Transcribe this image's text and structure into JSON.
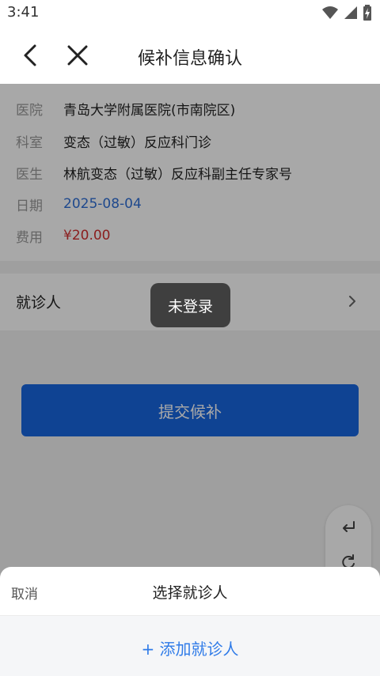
{
  "status_bar": {
    "time": "3:41",
    "icons": [
      "wifi-icon",
      "signal-icon",
      "battery-icon"
    ]
  },
  "nav": {
    "title": "候补信息确认",
    "back_icon": "chevron-left-icon",
    "close_icon": "close-icon"
  },
  "info": {
    "hospital_label": "医院",
    "hospital_value": "青岛大学附属医院(市南院区)",
    "department_label": "科室",
    "department_value": "变态（过敏）反应科门诊",
    "doctor_label": "医生",
    "doctor_value": "林航变态（过敏）反应科副主任专家号",
    "date_label": "日期",
    "date_value": "2025-08-04",
    "fee_label": "费用",
    "fee_value": "¥20.00"
  },
  "patient": {
    "label": "就诊人",
    "chevron_icon": "chevron-right-icon"
  },
  "submit": {
    "label": "提交候补"
  },
  "float_tools": {
    "icons": [
      "return-icon",
      "refresh-icon"
    ]
  },
  "toast": {
    "text": "未登录"
  },
  "sheet": {
    "cancel_label": "取消",
    "title": "选择就诊人",
    "add_label": "+ 添加就诊人"
  },
  "colors": {
    "primary_button": "#1766e0",
    "date_text": "#2f6fd6",
    "fee_text": "#d43030",
    "add_link": "#2f7be8",
    "overlay": "rgba(0,0,0,0.34)"
  }
}
